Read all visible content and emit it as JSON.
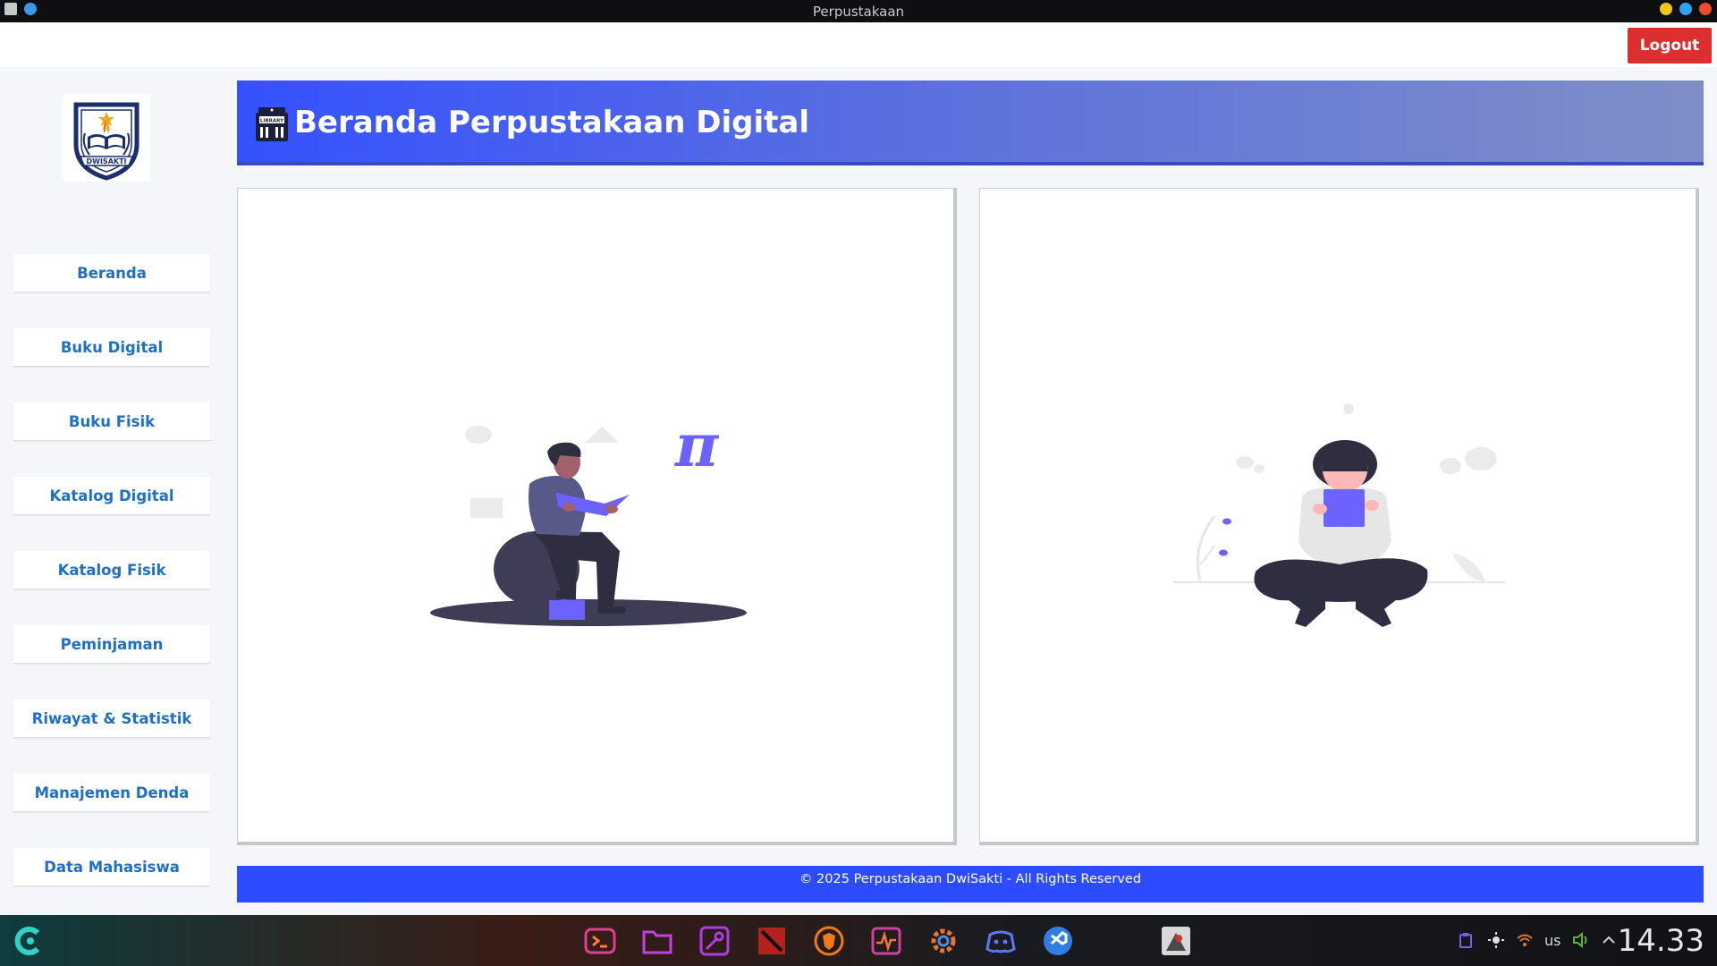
{
  "window": {
    "title": "Perpustakaan"
  },
  "topbar": {
    "logout_label": "Logout"
  },
  "sidebar": {
    "logo_text": "DWISAKTI",
    "items": [
      {
        "label": "Beranda"
      },
      {
        "label": "Buku Digital"
      },
      {
        "label": "Buku Fisik"
      },
      {
        "label": "Katalog Digital"
      },
      {
        "label": "Katalog Fisik"
      },
      {
        "label": "Peminjaman"
      },
      {
        "label": "Riwayat & Statistik"
      },
      {
        "label": "Manajemen Denda"
      },
      {
        "label": "Data Mahasiswa"
      }
    ]
  },
  "header": {
    "title": "Beranda Perpustakaan Digital",
    "icon_text": "LIBRARY"
  },
  "illustration_left": {
    "symbol": "π"
  },
  "footer": {
    "text": "© 2025 Perpustakaan DwiSakti - All Rights Reserved"
  },
  "taskbar": {
    "keyboard_layout": "us",
    "clock": "14.33"
  },
  "colors": {
    "header_gradient_start": "#3551ff",
    "footer": "#2d4cff",
    "logout": "#dc3030",
    "nav_text": "#1f6fc4",
    "accent_purple": "#6c63ff"
  }
}
